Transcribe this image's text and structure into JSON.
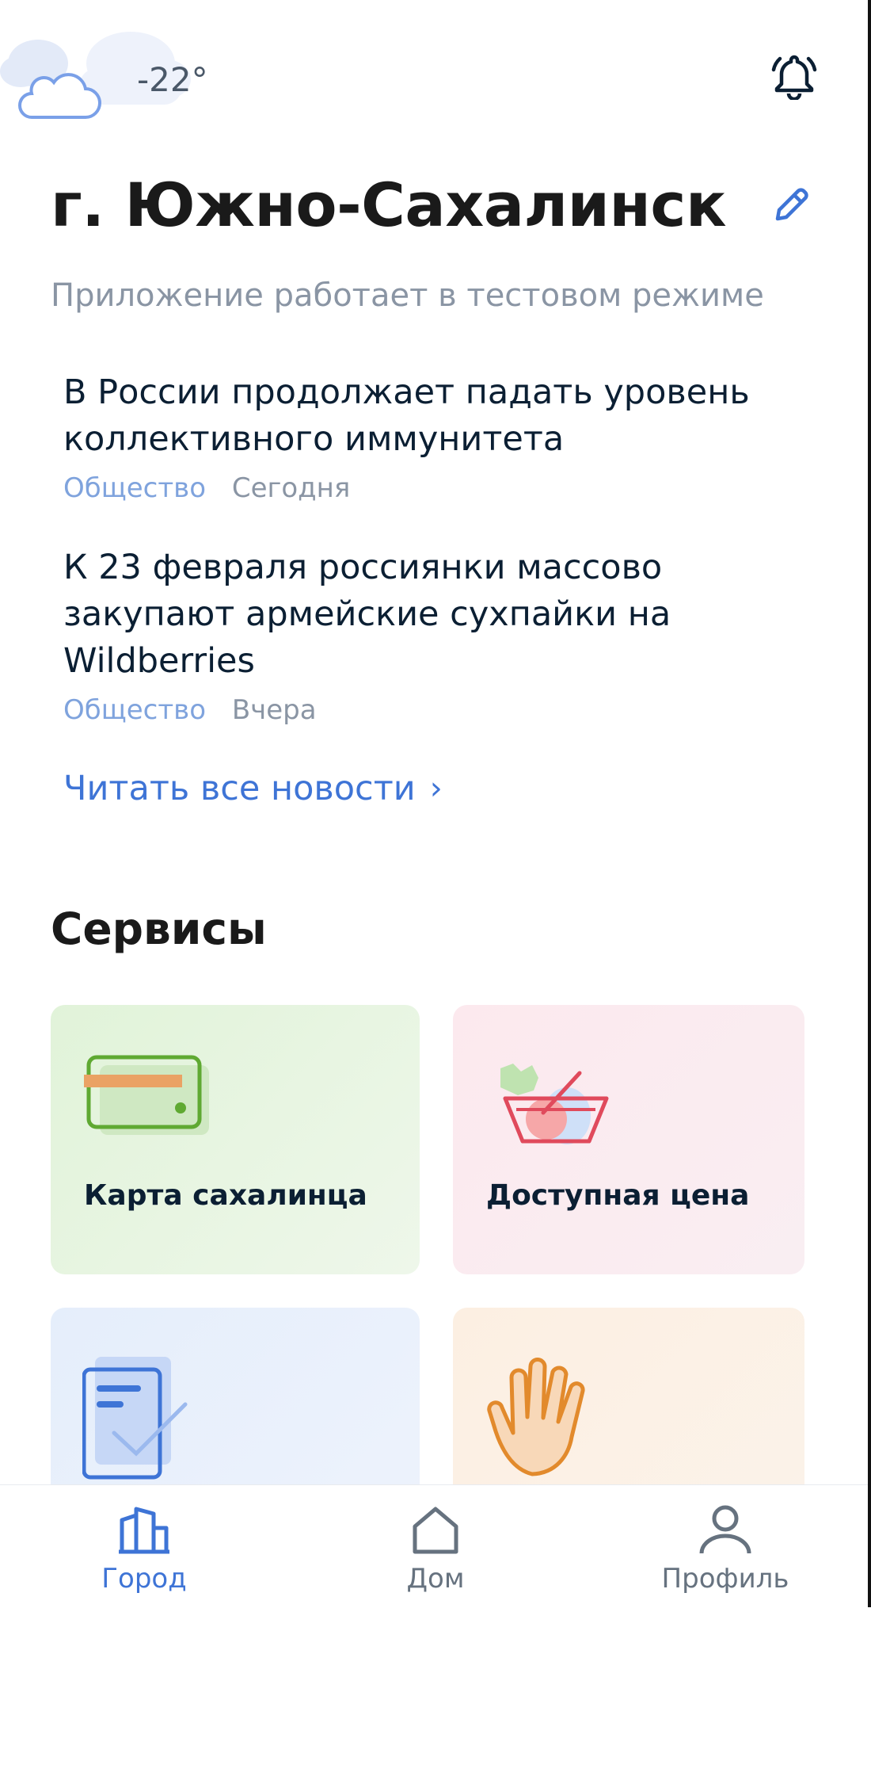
{
  "header": {
    "temperature": "-22°",
    "weather_icon": "cloud-icon",
    "notifications_icon": "bell-icon"
  },
  "city": {
    "name": "г. Южно-Сахалинск",
    "edit_icon": "pencil-icon",
    "notice": "Приложение работает в тестовом режиме"
  },
  "news": {
    "items": [
      {
        "title": "В России продолжает падать уровень коллективного иммунитета",
        "category": "Общество",
        "date": "Сегодня"
      },
      {
        "title": "К 23 февраля россиянки массово закупают армейские сухпайки на Wildberries",
        "category": "Общество",
        "date": "Вчера"
      }
    ],
    "read_all": "Читать все новости",
    "read_all_chevron": "›"
  },
  "services": {
    "title": "Сервисы",
    "items": [
      {
        "label": "Карта сахалинца",
        "icon": "card-icon"
      },
      {
        "label": "Доступная цена",
        "icon": "grocery-basket-icon"
      },
      {
        "label": "",
        "icon": "document-check-icon"
      },
      {
        "label": "",
        "icon": "hand-icon"
      }
    ]
  },
  "tabbar": {
    "tabs": [
      {
        "label": "Город",
        "icon": "city-buildings-icon",
        "active": true
      },
      {
        "label": "Дом",
        "icon": "house-icon",
        "active": false
      },
      {
        "label": "Профиль",
        "icon": "profile-icon",
        "active": false
      }
    ]
  },
  "colors": {
    "accent": "#3e74d6",
    "text_primary": "#0b1f33",
    "text_secondary": "#8a95a4",
    "category": "#7fa3dd"
  }
}
